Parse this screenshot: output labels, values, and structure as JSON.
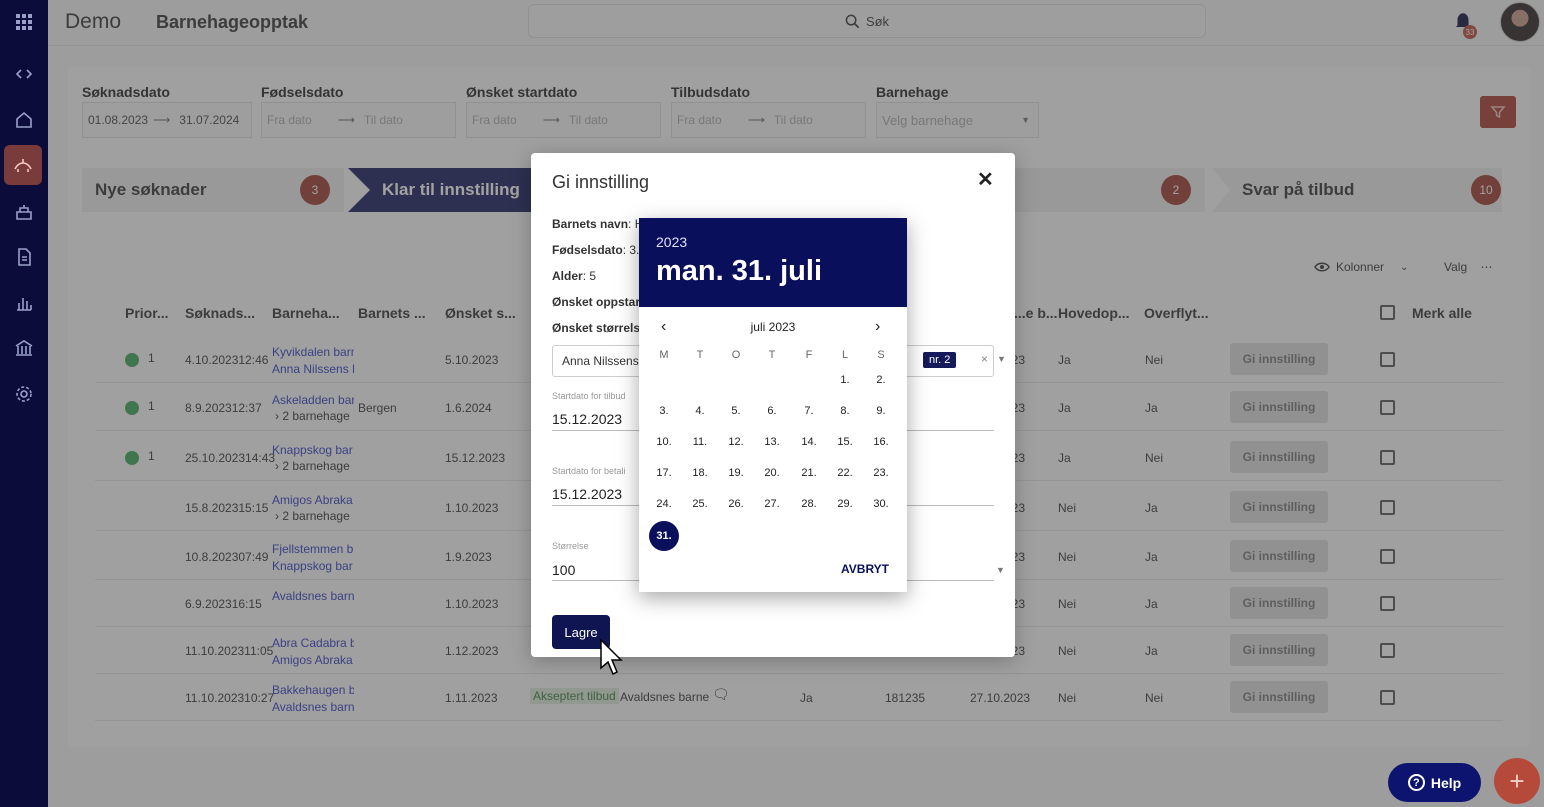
{
  "header": {
    "app_name": "Demo",
    "page_title": "Barnehageopptak",
    "search_placeholder": "Søk",
    "notification_count": "33"
  },
  "filters": {
    "soknadsdato": {
      "label": "Søknadsdato",
      "from": "01.08.2023",
      "to": "31.07.2024"
    },
    "fodselsdato": {
      "label": "Fødselsdato",
      "from": "Fra dato",
      "to": "Til dato"
    },
    "startdato": {
      "label": "Ønsket startdato",
      "from": "Fra dato",
      "to": "Til dato"
    },
    "tilbudsdato": {
      "label": "Tilbudsdato",
      "from": "Fra dato",
      "to": "Til dato"
    },
    "barnehage": {
      "label": "Barnehage",
      "placeholder": "Velg barnehage"
    }
  },
  "pipeline": {
    "nye": {
      "label": "Nye søknader",
      "count": "3"
    },
    "klar": {
      "label": "Klar til innstilling"
    },
    "middle": {
      "count": "2"
    },
    "svar": {
      "label": "Svar på tilbud",
      "count": "10"
    }
  },
  "table_tools": {
    "columns": "Kolonner",
    "options": "Valg"
  },
  "table": {
    "headers": [
      "Prior...",
      "Søknads...",
      "Barneha...",
      "Barnets ...",
      "Ønsket s...",
      "...e b...",
      "Hovedop...",
      "Overflyt...",
      "Merk alle"
    ],
    "action_label": "Gi innstilling",
    "rows": [
      {
        "prio": "1",
        "date": "4.10.202312:46",
        "bh1": "Kyvikdalen barn",
        "bh2": "Anna Nilssens N",
        "city": "",
        "start": "5.10.2023",
        "hoved": "Ja",
        "over": "Nei"
      },
      {
        "prio": "1",
        "date": "8.9.202312:37",
        "bh1": "Askeladden bar",
        "bh2": "2 barnehage",
        "city": "Bergen",
        "start": "1.6.2024",
        "hoved": "Ja",
        "over": "Ja"
      },
      {
        "prio": "1",
        "date": "25.10.202314:43",
        "bh1": "Knappskog bar",
        "bh2": "2 barnehage",
        "city": "",
        "start": "15.12.2023",
        "hoved": "Ja",
        "over": "Nei"
      },
      {
        "prio": "",
        "date": "15.8.202315:15",
        "bh1": "Amigos Abraka",
        "bh2": "2 barnehage",
        "city": "",
        "start": "1.10.2023",
        "hoved": "Nei",
        "over": "Ja"
      },
      {
        "prio": "",
        "date": "10.8.202307:49",
        "bh1": "Fjellstemmen b",
        "bh2": "Knappskog bar",
        "city": "",
        "start": "1.9.2023",
        "hoved": "Nei",
        "over": "Ja"
      },
      {
        "prio": "",
        "date": "6.9.202316:15",
        "bh1": "Avaldsnes barn",
        "bh2": "",
        "city": "",
        "start": "1.10.2023",
        "hoved": "Nei",
        "over": "Ja"
      },
      {
        "prio": "",
        "date": "11.10.202311:05",
        "bh1": "Abra Cadabra b",
        "bh2": "Amigos Abraka",
        "city": "",
        "start": "1.12.2023",
        "hoved": "Nei",
        "over": "Ja"
      },
      {
        "prio": "",
        "date": "11.10.202310:27",
        "bh1": "Bakkehaugen b",
        "bh2": "Avaldsnes barn",
        "city": "",
        "start": "1.11.2023",
        "hoved": "Nei",
        "over": "Nei",
        "status": "Akseptert tilbud",
        "bh_name": "Avaldsnes barne",
        "extra1": "Ja",
        "extra2": "181235",
        "extra3": "27.10.2023"
      }
    ]
  },
  "modal": {
    "title": "Gi innstilling",
    "barnets_navn_label": "Barnets navn",
    "barnets_navn": ": H",
    "fodselsdato_label": "Fødselsdato",
    "fodselsdato": ": 3.1",
    "alder_label": "Alder",
    "alder": ": 5",
    "oppstart_label": "Ønsket oppstar",
    "storrelse_label": "Ønsket størrels",
    "select_value": "Anna Nilssens",
    "chip": "nr. 2",
    "startdato_tilbud_caption": "Startdato for tilbud",
    "startdato_tilbud": "15.12.2023",
    "startdato_betaling_caption": "Startdato for betali",
    "startdato_betaling": "15.12.2023",
    "storrelse_caption": "Størrelse",
    "storrelse": "100",
    "save_label": "Lagre"
  },
  "calendar": {
    "year": "2023",
    "selected_display": "man. 31. juli",
    "month_label": "juli 2023",
    "weekdays": [
      "M",
      "T",
      "O",
      "T",
      "F",
      "L",
      "S"
    ],
    "days": [
      "1.",
      "2.",
      "3.",
      "4.",
      "5.",
      "6.",
      "7.",
      "8.",
      "9.",
      "10.",
      "11.",
      "12.",
      "13.",
      "14.",
      "15.",
      "16.",
      "17.",
      "18.",
      "19.",
      "20.",
      "21.",
      "22.",
      "23.",
      "24.",
      "25.",
      "26.",
      "27.",
      "28.",
      "29.",
      "30.",
      "31."
    ],
    "first_weekday_index": 5,
    "selected_day": "31.",
    "cancel_label": "AVBRYT"
  },
  "help": {
    "label": "Help"
  },
  "colors": {
    "navy": "#0a0f5c",
    "accent_red": "#a83a2e",
    "success": "#3aa655"
  }
}
